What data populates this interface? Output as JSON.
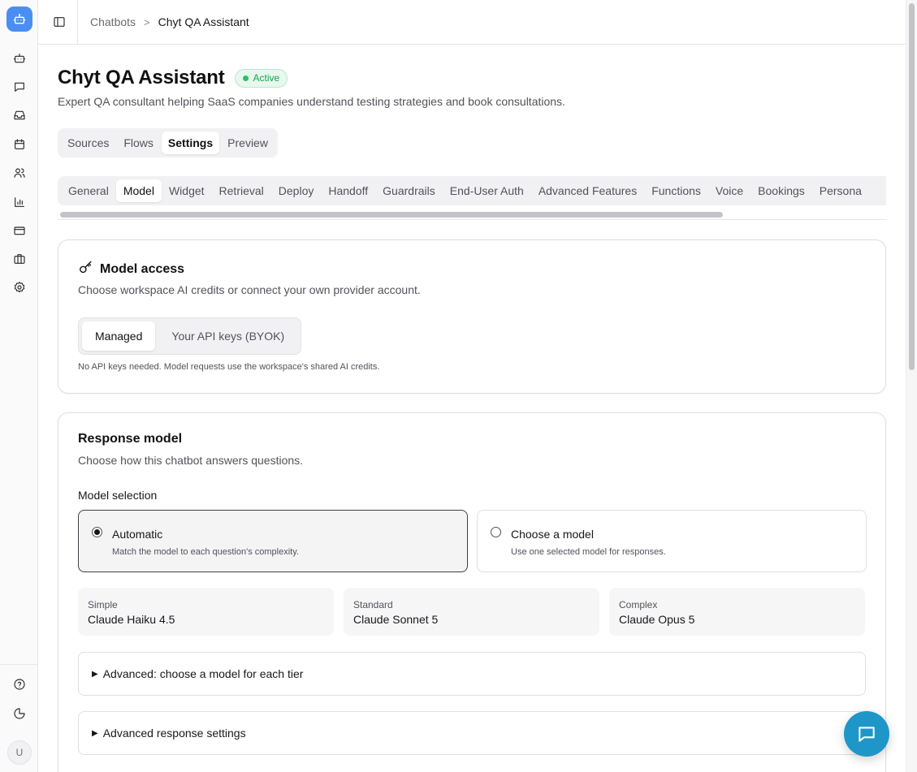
{
  "breadcrumb": {
    "parent": "Chatbots",
    "separator": ">",
    "current": "Chyt QA Assistant"
  },
  "header": {
    "title": "Chyt QA Assistant",
    "status": "Active",
    "description": "Expert QA consultant helping SaaS companies understand testing strategies and book consultations."
  },
  "primary_tabs": [
    "Sources",
    "Flows",
    "Settings",
    "Preview"
  ],
  "primary_active": "Settings",
  "settings_tabs": [
    "General",
    "Model",
    "Widget",
    "Retrieval",
    "Deploy",
    "Handoff",
    "Guardrails",
    "End-User Auth",
    "Advanced Features",
    "Functions",
    "Voice",
    "Bookings",
    "Persona"
  ],
  "settings_active": "Model",
  "model_access": {
    "title": "Model access",
    "description": "Choose workspace AI credits or connect your own provider account.",
    "options": [
      "Managed",
      "Your API keys (BYOK)"
    ],
    "selected": "Managed",
    "help": "No API keys needed. Model requests use the workspace's shared AI credits."
  },
  "response_model": {
    "title": "Response model",
    "description": "Choose how this chatbot answers questions.",
    "selection_label": "Model selection",
    "automatic": {
      "title": "Automatic",
      "subtitle": "Match the model to each question's complexity."
    },
    "choose": {
      "title": "Choose a model",
      "subtitle": "Use one selected model for responses."
    },
    "selected_mode": "automatic",
    "tiers": [
      {
        "label": "Simple",
        "model": "Claude Haiku 4.5"
      },
      {
        "label": "Standard",
        "model": "Claude Sonnet 5"
      },
      {
        "label": "Complex",
        "model": "Claude Opus 5"
      }
    ],
    "advanced_tiers_label": "Advanced: choose a model for each tier",
    "advanced_response_label": "Advanced response settings",
    "disclosure_marker": "▶"
  },
  "user": {
    "initial": "U"
  },
  "icons": {
    "logo": "bot-icon",
    "rail": [
      "bot-icon",
      "message-icon",
      "inbox-icon",
      "calendar-icon",
      "users-icon",
      "chart-icon",
      "credit-card-icon",
      "briefcase-icon",
      "settings-icon"
    ],
    "rail_bottom": [
      "help-icon",
      "theme-icon"
    ],
    "model_access": "key-icon",
    "chat_fab": "chat-icon"
  },
  "colors": {
    "logo": "#4a8ef2",
    "active_badge": "#16a34a",
    "chat_fab": "#1e96c8"
  }
}
